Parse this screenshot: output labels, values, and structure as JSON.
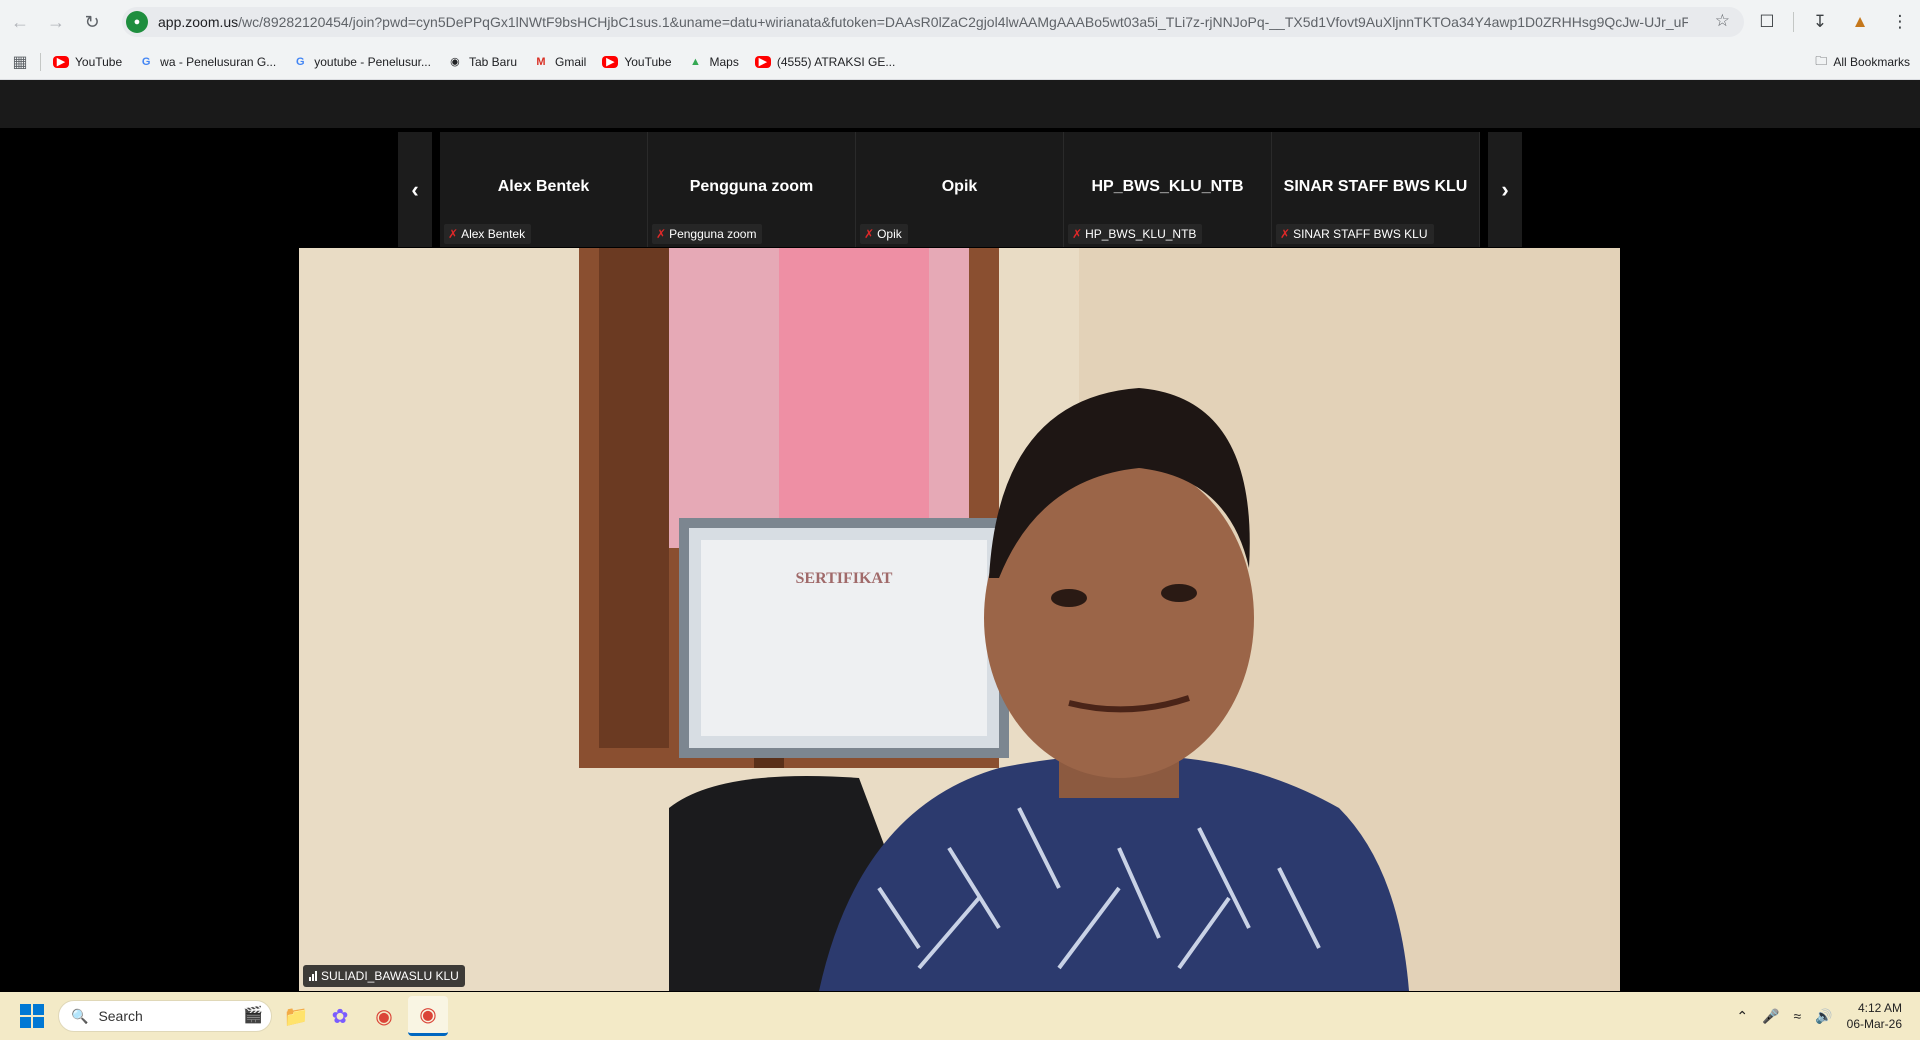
{
  "browser": {
    "url_host": "app.zoom.us",
    "url_path": "/wc/89282120454/join?pwd=cyn5DePPqGx1lNWtF9bsHCHjbC1sus.1&uname=datu+wirianata&futoken=DAAsR0lZaC2gjol4lwAAMgAAABo5wt03a5i_TLi7z-rjNNJoPq-__TX5d1Vfovt9AuXljnnTKTOa34Y4awp1D0ZRHHsg9QcJw-UJr_uFWIZX...",
    "bookmarks": [
      {
        "label": "YouTube",
        "icon": "youtube-icon"
      },
      {
        "label": "wa - Penelusuran G...",
        "icon": "google-icon"
      },
      {
        "label": "youtube - Penelusur...",
        "icon": "google-icon"
      },
      {
        "label": "Tab Baru",
        "icon": "chrome-icon"
      },
      {
        "label": "Gmail",
        "icon": "gmail-icon"
      },
      {
        "label": "YouTube",
        "icon": "youtube-icon"
      },
      {
        "label": "Maps",
        "icon": "maps-icon"
      },
      {
        "label": "(4555) ATRAKSI GE...",
        "icon": "youtube-icon"
      }
    ],
    "all_bookmarks": "All Bookmarks"
  },
  "zoom": {
    "participants": [
      {
        "big_name": "Alex Bentek",
        "tag": "Alex Bentek"
      },
      {
        "big_name": "Pengguna zoom",
        "tag": "Pengguna zoom"
      },
      {
        "big_name": "Opik",
        "tag": "Opik"
      },
      {
        "big_name": "HP_BWS_KLU_NTB",
        "tag": "HP_BWS_KLU_NTB"
      },
      {
        "big_name": "SINAR STAFF BWS KLU",
        "tag": "SINAR STAFF BWS KLU"
      }
    ],
    "active_speaker": "SULIADI_BAWASLU KLU",
    "certificate_text": "SERTIFIKAT"
  },
  "taskbar": {
    "search_placeholder": "Search",
    "time": "4:12 AM",
    "date": "06-Mar-26"
  }
}
